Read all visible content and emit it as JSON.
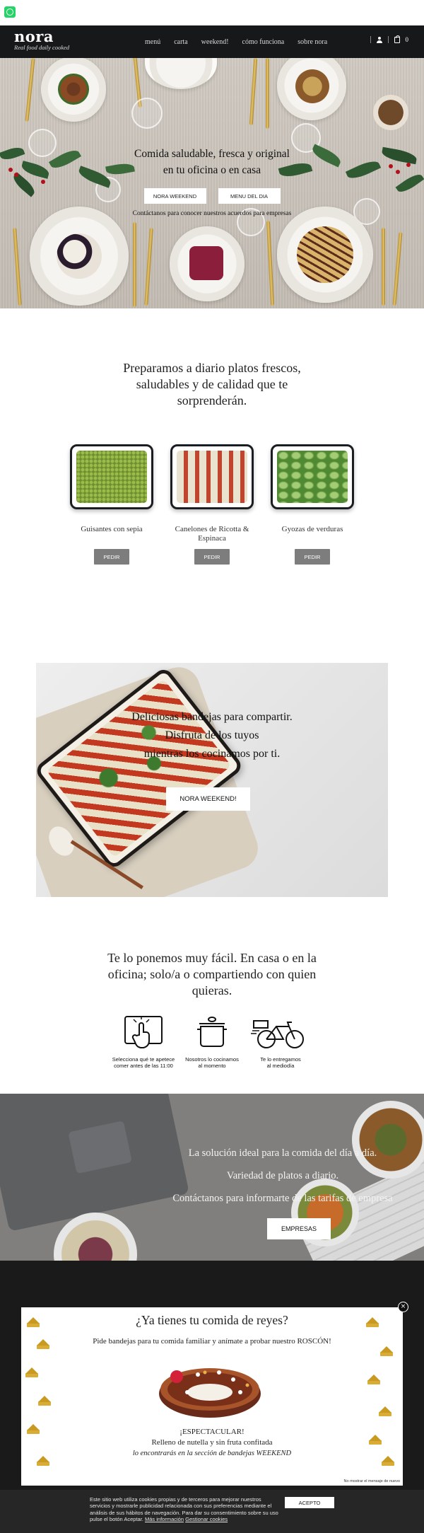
{
  "whatsapp": {
    "icon": "whatsapp-icon"
  },
  "header": {
    "logo": "nora",
    "tagline": "Real food daily cooked",
    "nav": [
      "menú",
      "carta",
      "weekend!",
      "cómo funciona",
      "sobre nora"
    ],
    "cart_count": "0"
  },
  "hero": {
    "title_line1": "Comida saludable, fresca y original",
    "title_line2": "en tu oficina o en casa",
    "btn_weekend": "NORA WEEKEND",
    "btn_menu": "MENU DEL DIA",
    "note": "Contáctanos para conocer nuestros acuerdos para empresas"
  },
  "intro": {
    "line1": "Preparamos a diario platos frescos,",
    "line2": "saludables y de calidad que te",
    "line3": "sorprenderán."
  },
  "products": [
    {
      "name": "Guisantes con sepia",
      "button": "PEDIR",
      "color": "#7a9a3a"
    },
    {
      "name": "Canelones de Ricotta & Espinaca",
      "button": "PEDIR",
      "color": "#c0452f"
    },
    {
      "name": "Gyozas de verduras",
      "button": "PEDIR",
      "color": "#6ea34a"
    }
  ],
  "weekend": {
    "line1": "Deliciosas bandejas para compartir.",
    "line2": "Disfruta de los tuyos",
    "line3": "mientras los cocinamos por ti.",
    "button": "NORA WEEKEND!"
  },
  "how": {
    "line1": "Te lo ponemos muy fácil. En casa o en la",
    "line2": "oficina; solo/a o compartiendo con quien",
    "line3": "quieras.",
    "steps": [
      {
        "l1": "Selecciona qué te apetece",
        "l2": "comer antes de las 11:00",
        "icon": "tap-screen-icon"
      },
      {
        "l1": "Nosotros lo cocinamos",
        "l2": "al momento",
        "icon": "cooking-pot-icon"
      },
      {
        "l1": "Te lo entregamos",
        "l2": "al mediodía",
        "icon": "bicycle-icon"
      }
    ]
  },
  "empresas": {
    "line1": "La solución ideal para la comida del día a día.",
    "line2": "Variedad de platos a diario.",
    "line3": "Contáctanos para informarte de las tarifas de empresa",
    "button": "EMPRESAS"
  },
  "popup": {
    "title": "¿Ya tienes tu comida de reyes?",
    "subtitle": "Pide bandejas para tu comida familiar y anímate a probar nuestro ROSCÓN!",
    "line1": "¡ESPECTACULAR!",
    "line2": "Relleno de nutella y sin fruta confitada",
    "line3": "lo encontrarás en la sección de bandejas WEEKEND",
    "dismiss": "No mostrar el mensaje de nuevo",
    "close": "×"
  },
  "cookie": {
    "text": "Este sitio web utiliza cookies propias y de terceros para mejorar nuestros servicios y mostrarle publicidad relacionada con sus preferencias mediante el análisis de sus hábitos de navegación. Para dar su consentimiento sobre su uso pulse el botón Aceptar.",
    "more_info": "Más información",
    "manage": "Gestionar cookies",
    "accept": "ACEPTO"
  },
  "colors": {
    "header_bg": "#17181a",
    "pedir_bg": "#7d7d7d",
    "whatsapp": "#25d366",
    "cookie_bg": "#262626"
  }
}
